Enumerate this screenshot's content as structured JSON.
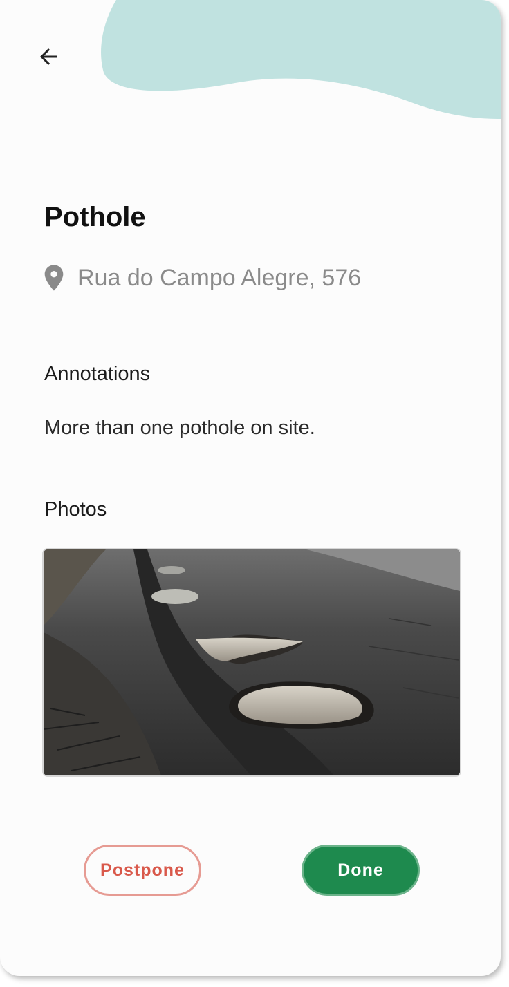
{
  "colors": {
    "accent_blob": "#c0e2e0",
    "done_bg": "#1e8a4e",
    "postpone_text": "#d9594b"
  },
  "header": {
    "back_icon": "arrow-left-icon"
  },
  "issue": {
    "title": "Pothole",
    "location_icon": "location-pin-icon",
    "location": "Rua do Campo Alegre, 576"
  },
  "annotations": {
    "label": "Annotations",
    "text": "More than one pothole on site."
  },
  "photos": {
    "label": "Photos",
    "items": [
      "road-with-potholes-photo"
    ]
  },
  "actions": {
    "postpone_label": "Postpone",
    "done_label": "Done"
  }
}
